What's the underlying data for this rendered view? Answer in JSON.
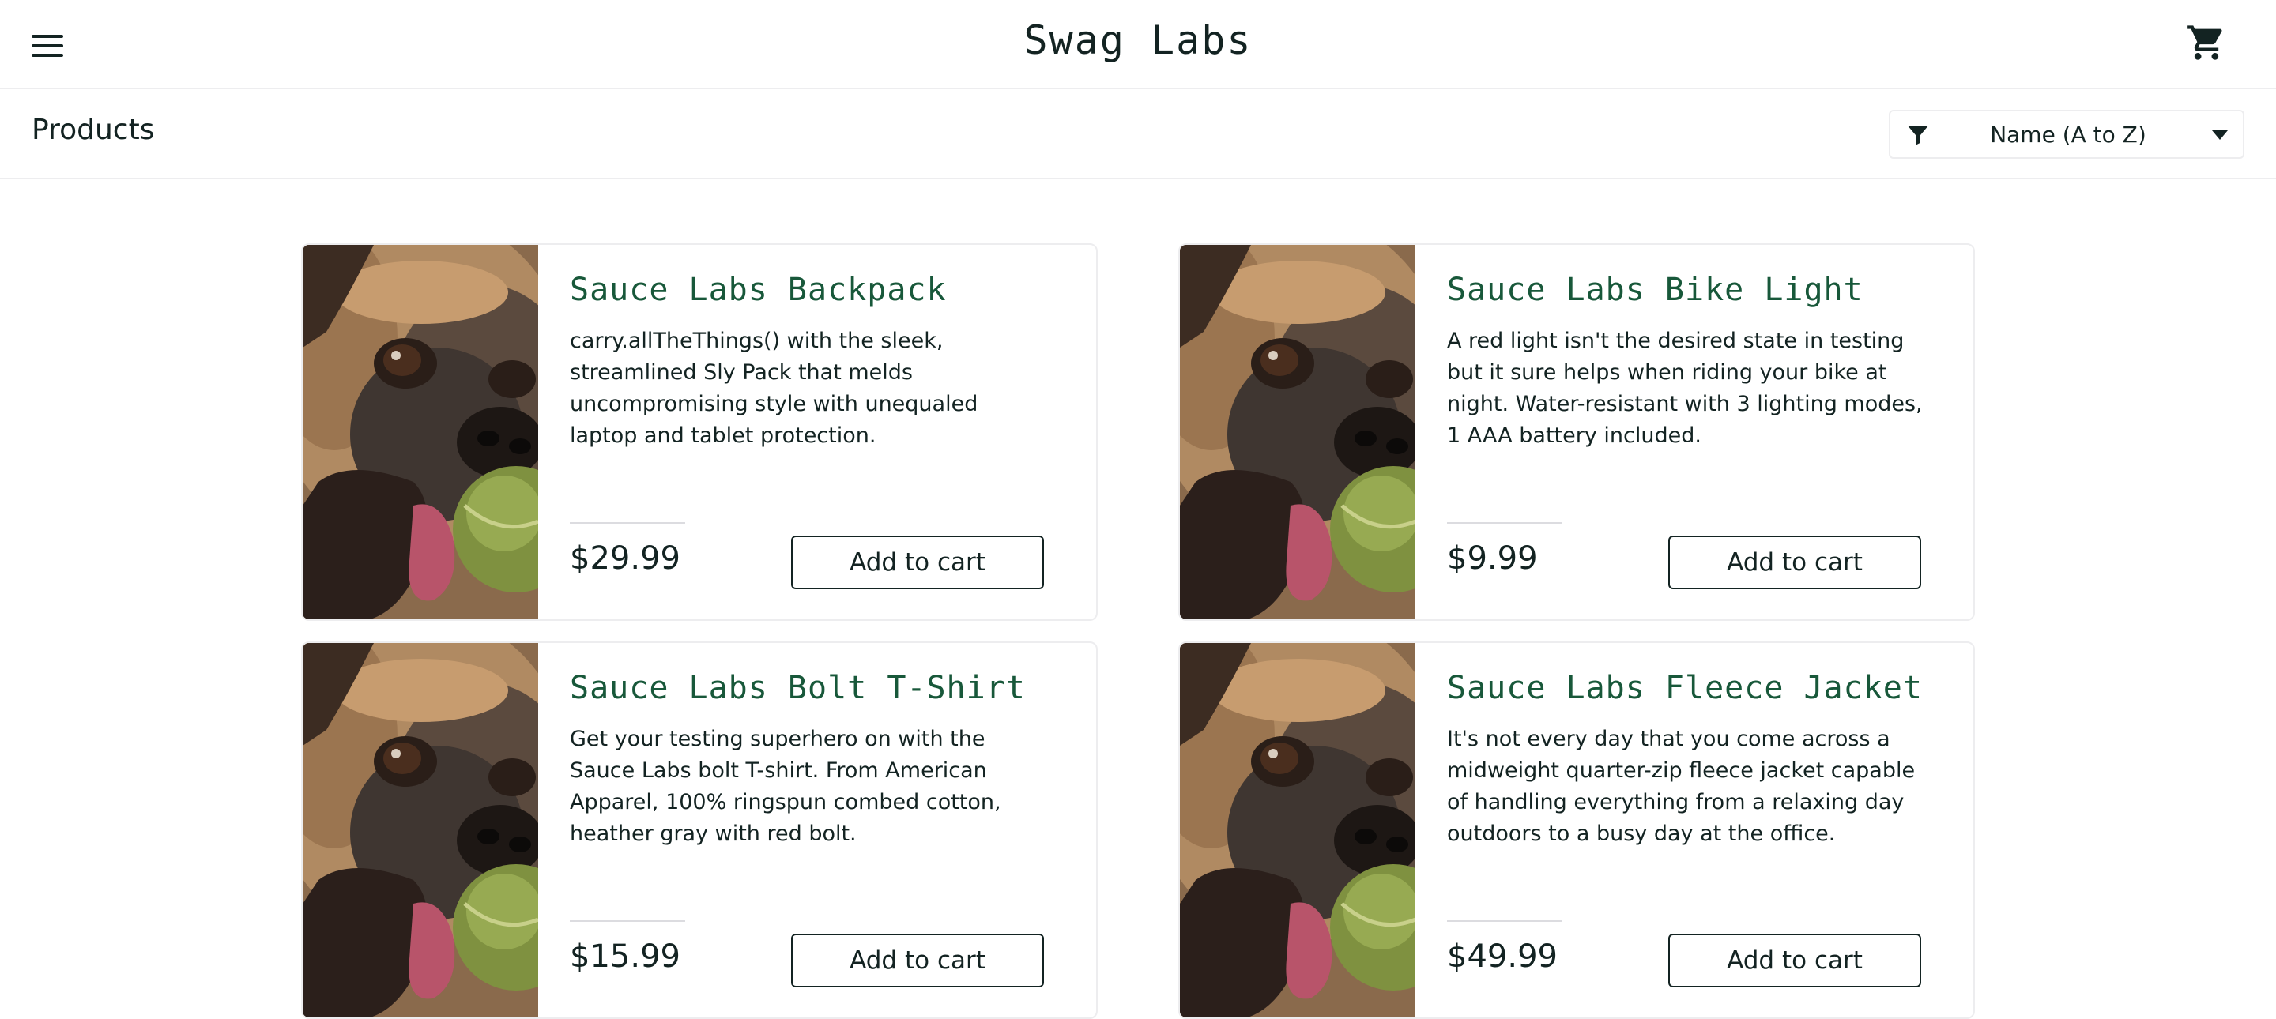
{
  "header": {
    "app_title": "Swag Labs",
    "menu_icon": "hamburger-menu-icon",
    "cart_icon": "shopping-cart-icon"
  },
  "subheader": {
    "title": "Products",
    "sort": {
      "icon": "filter-icon",
      "selected": "Name (A to Z)"
    }
  },
  "colors": {
    "product_name": "#18583a",
    "text": "#132322",
    "border": "#ededef"
  },
  "products": [
    {
      "name": "Sauce Labs Backpack",
      "description": "carry.allTheThings() with the sleek, streamlined Sly Pack that melds uncompromising style with unequaled laptop and tablet protection.",
      "price": "$29.99",
      "button": "Add to cart"
    },
    {
      "name": "Sauce Labs Bike Light",
      "description": "A red light isn't the desired state in testing but it sure helps when riding your bike at night. Water-resistant with 3 lighting modes, 1 AAA battery included.",
      "price": "$9.99",
      "button": "Add to cart"
    },
    {
      "name": "Sauce Labs Bolt T-Shirt",
      "description": "Get your testing superhero on with the Sauce Labs bolt T-shirt. From American Apparel, 100% ringspun combed cotton, heather gray with red bolt.",
      "price": "$15.99",
      "button": "Add to cart"
    },
    {
      "name": "Sauce Labs Fleece Jacket",
      "description": "It's not every day that you come across a midweight quarter-zip fleece jacket capable of handling everything from a relaxing day outdoors to a busy day at the office.",
      "price": "$49.99",
      "button": "Add to cart"
    }
  ]
}
